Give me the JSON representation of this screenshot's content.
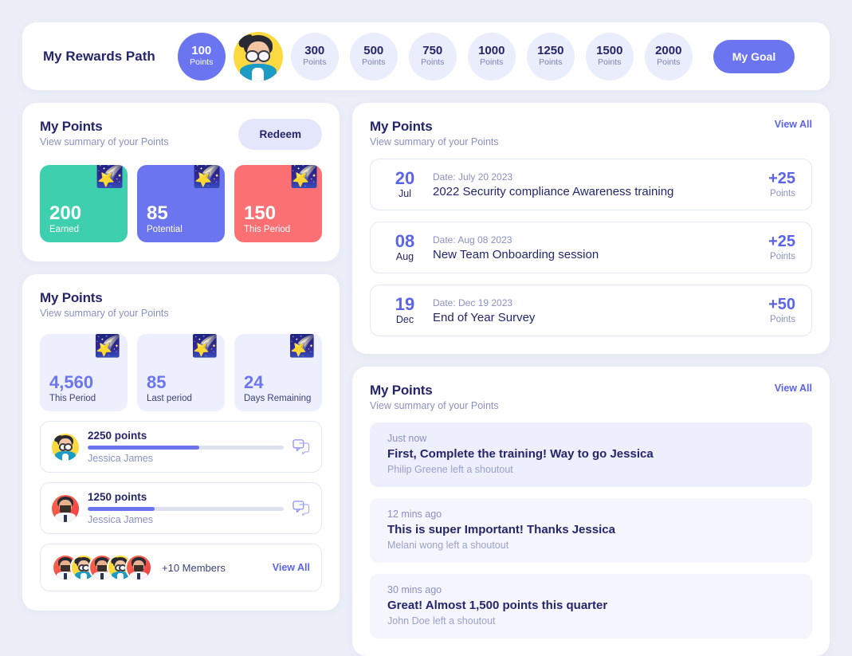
{
  "theme": {
    "page_bg": "#EBEEF7",
    "accent": "#6B75EF",
    "accent_dark": "#25256B",
    "muted": "#8A90C4",
    "tile_earned": "#3ECFAF",
    "tile_potential": "#6B75EF",
    "tile_period": "#FB7173"
  },
  "rewards_path": {
    "title": "My Rewards Path",
    "steps": [
      {
        "value": "100",
        "unit": "Points",
        "active": true
      },
      {
        "value": "300",
        "unit": "Points",
        "active": false
      },
      {
        "value": "500",
        "unit": "Points",
        "active": false
      },
      {
        "value": "750",
        "unit": "Points",
        "active": false
      },
      {
        "value": "1000",
        "unit": "Points",
        "active": false
      },
      {
        "value": "1250",
        "unit": "Points",
        "active": false
      },
      {
        "value": "1500",
        "unit": "Points",
        "active": false
      },
      {
        "value": "2000",
        "unit": "Points",
        "active": false
      }
    ],
    "goal_button": "My Goal",
    "avatar_after_step": 1
  },
  "points_summary": {
    "title": "My Points",
    "subtitle": "View summary of your Points",
    "redeem_label": "Redeem",
    "tiles": [
      {
        "value": "200",
        "label": "Earned",
        "color": "#3ECFAF",
        "icon": "shooting-star-icon"
      },
      {
        "value": "85",
        "label": "Potential",
        "color": "#6B75EF",
        "icon": "shooting-star-icon"
      },
      {
        "value": "150",
        "label": "This Period",
        "color": "#FB7173",
        "icon": "shooting-star-icon"
      }
    ]
  },
  "points_stats": {
    "title": "My Points",
    "subtitle": "View summary of your Points",
    "tiles": [
      {
        "value": "4,560",
        "label": "This Period",
        "icon": "shooting-star-icon"
      },
      {
        "value": "85",
        "label": "Last period",
        "icon": "shooting-star-icon"
      },
      {
        "value": "24",
        "label": "Days Remaining",
        "icon": "shooting-star-icon"
      }
    ],
    "leaderboard": [
      {
        "points": "2250 points",
        "name": "Jessica James",
        "progress": 57,
        "avatar": "yellow"
      },
      {
        "points": "1250 points",
        "name": "Jessica James",
        "progress": 34,
        "avatar": "red"
      }
    ],
    "members": {
      "count_label": "+10 Members",
      "view_all": "View All",
      "avatars": [
        "red",
        "yellow",
        "red",
        "yellow",
        "red"
      ]
    }
  },
  "points_feed": {
    "title": "My Points",
    "subtitle": "View summary of your Points",
    "view_all": "View All",
    "entries": [
      {
        "day": "20",
        "month": "Jul",
        "date_text": "Date: July 20 2023",
        "title": "2022 Security compliance Awareness training",
        "points": "+25",
        "points_unit": "Points"
      },
      {
        "day": "08",
        "month": "Aug",
        "date_text": "Date: Aug  08 2023",
        "title": "New Team Onboarding session",
        "points": "+25",
        "points_unit": "Points"
      },
      {
        "day": "19",
        "month": "Dec",
        "date_text": "Date: Dec  19 2023",
        "title": "End of Year Survey",
        "points": "+50",
        "points_unit": "Points"
      }
    ]
  },
  "shoutouts": {
    "title": "My Points",
    "subtitle": "View summary of your Points",
    "view_all": "View All",
    "items": [
      {
        "when": "Just now",
        "message": "First, Complete the training! Way to go Jessica",
        "by": "Philip Greene left a shoutout",
        "highlighted": true
      },
      {
        "when": "12 mins ago",
        "message": "This is super Important! Thanks Jessica",
        "by": "Melani wong left a shoutout",
        "highlighted": false
      },
      {
        "when": "30 mins ago",
        "message": "Great! Almost 1,500 points this quarter",
        "by": "John Doe left a shoutout",
        "highlighted": false
      }
    ]
  }
}
